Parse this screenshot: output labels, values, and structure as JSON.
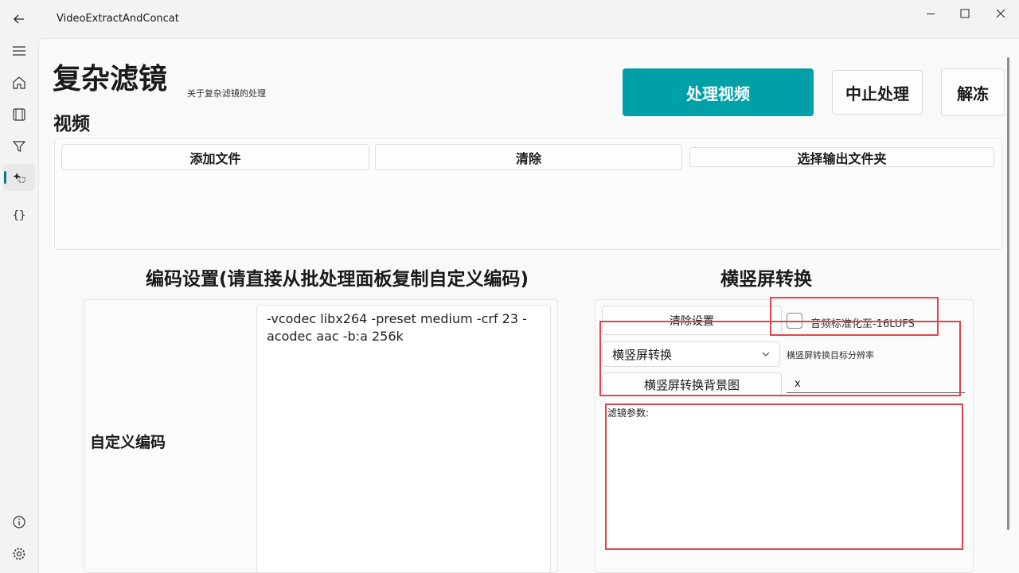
{
  "window": {
    "title": "VideoExtractAndConcat",
    "controls": [
      "minimize-icon",
      "maximize-icon",
      "close-icon"
    ]
  },
  "nav": {
    "items": [
      {
        "name": "menu-icon"
      },
      {
        "name": "home-icon"
      },
      {
        "name": "film-icon"
      },
      {
        "name": "filter-icon"
      },
      {
        "name": "sparkle-icon",
        "active": true
      },
      {
        "name": "braces-icon"
      }
    ],
    "footer": [
      {
        "name": "info-icon"
      },
      {
        "name": "settings-icon"
      }
    ],
    "accent": "#0e7c86"
  },
  "header": {
    "title": "复杂滤镜",
    "subtitle": "关于复杂滤镜的处理",
    "process_label": "处理视频",
    "stop_label": "中止处理",
    "unfreeze_label": "解冻",
    "primary_color": "#00a0a8"
  },
  "video": {
    "heading": "视频",
    "add_label": "添加文件",
    "clear_label": "清除",
    "output_label": "选择输出文件夹"
  },
  "encoding": {
    "heading": "编码设置(请直接从批处理面板复制自定义编码)",
    "custom_label": "自定义编码",
    "custom_value": "-vcodec libx264 -preset medium -crf 23 -acodec aac -b:a 256k"
  },
  "orientation": {
    "heading": "横竖屏转换",
    "clear_settings_label": "清除设置",
    "normalize_label": "音频标准化至-16LUFS",
    "normalize_checked": false,
    "mode_value": "横竖屏转换",
    "resolution_label": "横竖屏转换目标分辨率",
    "background_label": "横竖屏转换背景图",
    "resolution_value": "x",
    "filter_params_label": "滤镜参数:"
  },
  "highlight_color": "#e0454e"
}
